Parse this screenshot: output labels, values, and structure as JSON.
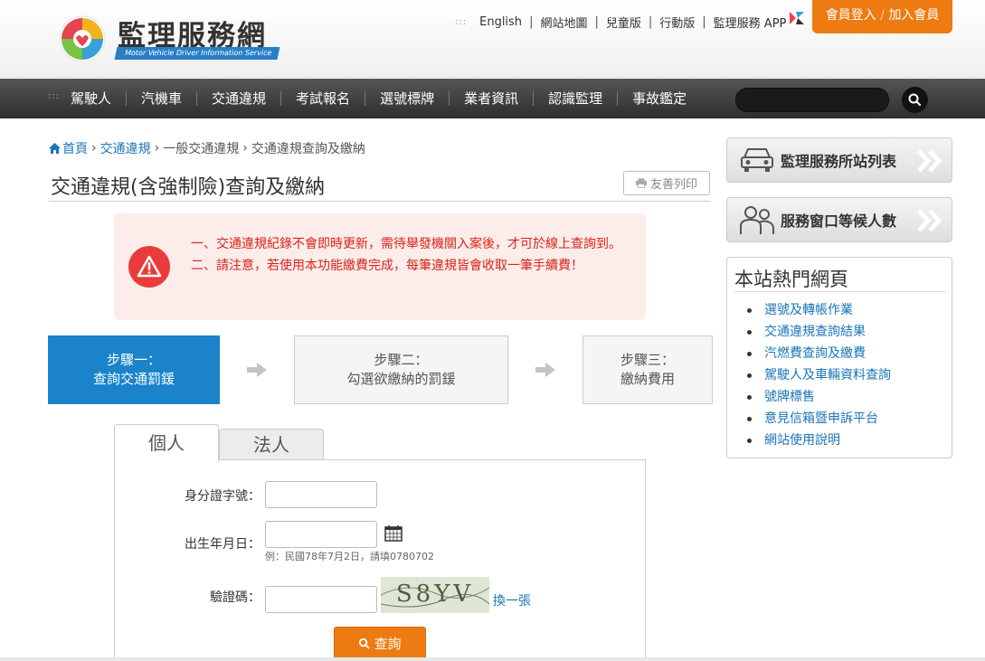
{
  "header": {
    "logo_title": "監理服務網",
    "logo_subtitle": "Motor Vehicle Driver Information Service",
    "top_links": [
      "English",
      "網站地圖",
      "兒童版",
      "行動版",
      "監理服務 APP"
    ],
    "login": "會員登入",
    "join": "加入會員"
  },
  "nav": {
    "items": [
      "駕駛人",
      "汽機車",
      "交通違規",
      "考試報名",
      "選號標牌",
      "業者資訊",
      "認識監理",
      "事故鑑定"
    ],
    "search_placeholder": ""
  },
  "breadcrumb": [
    "首頁",
    "交通違規",
    "一般交通違規",
    "交通違規查詢及繳納"
  ],
  "page_title": "交通違規(含強制險)查詢及繳納",
  "print_label": "友善列印",
  "alert": {
    "line1": "一、交通違規紀錄不會即時更新，需待舉發機關入案後，才可於線上查詢到。",
    "line2": "二、請注意，若使用本功能繳費完成，每筆違規皆會收取一筆手續費！"
  },
  "steps": [
    {
      "title": "步驟一：",
      "desc": "查詢交通罰鍰"
    },
    {
      "title": "步驟二：",
      "desc": "勾選欲繳納的罰鍰"
    },
    {
      "title": "步驟三：",
      "desc": "繳納費用"
    }
  ],
  "tabs": [
    "個人",
    "法人"
  ],
  "form": {
    "id_label": "身分證字號：",
    "birth_label": "出生年月日：",
    "birth_hint": "例：民國78年7月2日，請填0780702",
    "captcha_label": "驗證碼：",
    "captcha_text": "S8YV",
    "refresh": "換一張",
    "submit": "查詢"
  },
  "sidebar": {
    "btn1": "監理服務所站列表",
    "btn2": "服務窗口等候人數",
    "hot_title": "本站熱門網頁",
    "hot_links": [
      "選號及轉帳作業",
      "交通違規查詢結果",
      "汽燃費查詢及繳費",
      "駕駛人及車輛資料查詢",
      "號牌標售",
      "意見信箱暨申訴平台",
      "網站使用說明"
    ]
  }
}
